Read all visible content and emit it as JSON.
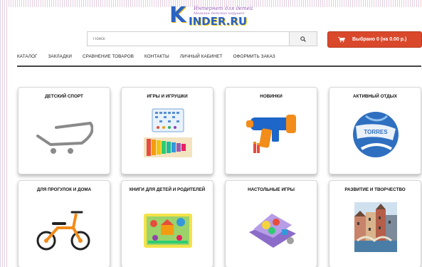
{
  "logo": {
    "big_letter": "K",
    "rest": "INDER.RU",
    "tagline_1": "Интернет для детей",
    "tagline_2": "Магазин детских игрушек"
  },
  "search": {
    "placeholder": "Поиск",
    "button_icon": "search-icon"
  },
  "cart": {
    "label": "Выбрано 0 (на 0.00 р.)",
    "icon": "cart-icon",
    "color": "#d9482b"
  },
  "nav": {
    "items": [
      {
        "label": "КАТАЛОГ"
      },
      {
        "label": "ЗАКЛАДКИ"
      },
      {
        "label": "СРАВНЕНИЕ ТОВАРОВ"
      },
      {
        "label": "КОНТАКТЫ"
      },
      {
        "label": "ЛИЧНЫЙ КАБИНЕТ"
      },
      {
        "label": "ОФОРМИТЬ ЗАКАЗ"
      }
    ]
  },
  "categories": [
    {
      "title": "ДЕТСКИЙ СПОРТ",
      "image": "cart-placeholder-image"
    },
    {
      "title": "ИГРЫ И ИГРУШКИ",
      "image": "xylophone-image"
    },
    {
      "title": "НОВИНКИ",
      "image": "toy-blaster-image"
    },
    {
      "title": "АКТИВНЫЙ ОТДЫХ",
      "image": "soccer-ball-image",
      "image_text": "TORRES"
    },
    {
      "title": "ДЛЯ ПРОГУЛОК И ДОМА",
      "image": "balance-bike-image"
    },
    {
      "title": "КНИГИ ДЛЯ ДЕТЕЙ И РОДИТЕЛЕЙ",
      "image": "kids-book-image"
    },
    {
      "title": "НАСТОЛЬНЫЕ ИГРЫ",
      "image": "board-game-image"
    },
    {
      "title": "РАЗВИТИЕ И ТВОРЧЕСТВО",
      "image": "paint-by-numbers-image"
    }
  ]
}
